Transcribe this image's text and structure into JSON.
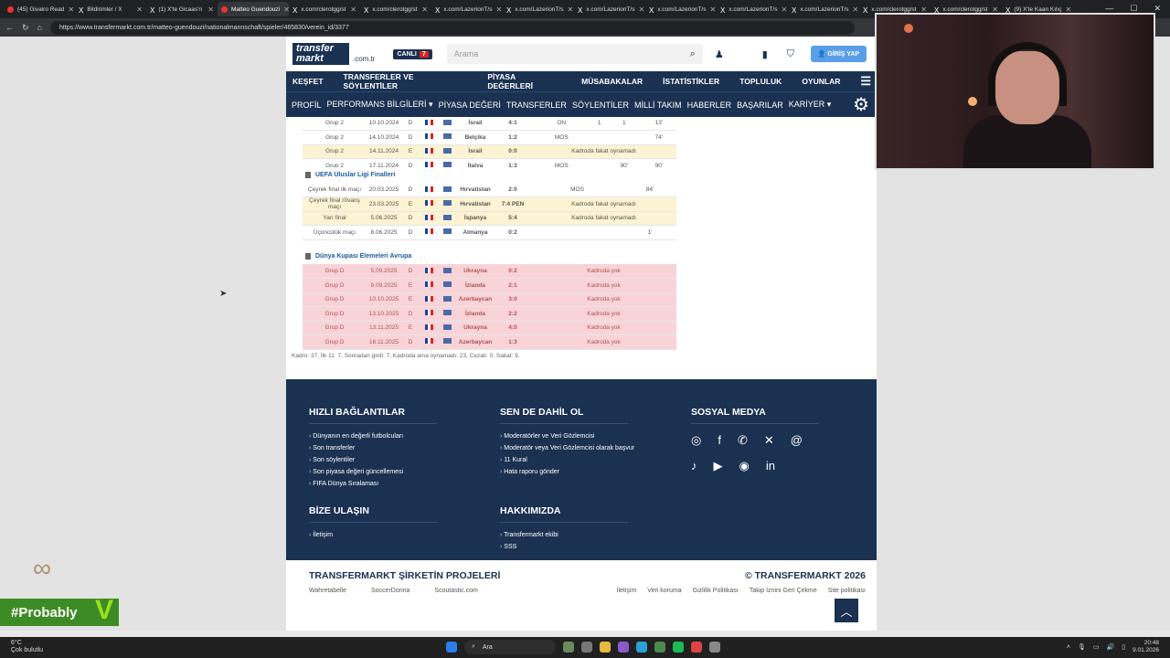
{
  "browser": {
    "tabs": [
      {
        "title": "(45) Givairo Read"
      },
      {
        "title": "Bildirimler / X"
      },
      {
        "title": "(1) X'te Gicaas'n"
      },
      {
        "title": "Matteo Guendouzi"
      },
      {
        "title": "x.com/clerotgg/st"
      },
      {
        "title": "x.com/clerotgg/st"
      },
      {
        "title": "x.com/LazerionT/s"
      },
      {
        "title": "x.com/LazerionT/s"
      },
      {
        "title": "x.com/LazerionT/s"
      },
      {
        "title": "x.com/LazerionT/s"
      },
      {
        "title": "x.com/LazerionT/s"
      },
      {
        "title": "x.com/LazerionT/s"
      },
      {
        "title": "x.com/clerotgg/st"
      },
      {
        "title": "x.com/clerotgg/st"
      },
      {
        "title": "(9) X'te Kaan Kılıç"
      }
    ],
    "url": "https://www.transfermarkt.com.tr/matteo-guendouzi/nationalmannschaft/spieler/465830/verein_id/3377"
  },
  "site": {
    "logo_top": "transfer",
    "logo_bottom": "markt",
    "domain": ".com.tr",
    "live_label": "CANLI",
    "live_count": "7",
    "search_placeholder": "Arama",
    "login_label": "GİRİŞ YAP",
    "nav_main": [
      "KEŞFET",
      "TRANSFERLER VE SÖYLENTİLER",
      "PİYASA DEĞERLERİ",
      "MÜSABAKALAR",
      "İSTATİSTİKLER",
      "TOPLULUK",
      "OYUNLAR"
    ],
    "nav_sub": [
      "PROFİL",
      "PERFORMANS BİLGİLERİ ▾",
      "PİYASA DEĞERİ",
      "TRANSFERLER",
      "SÖYLENTİLER",
      "MİLLİ TAKIM",
      "HABERLER",
      "BAŞARILAR",
      "KARİYER ▾"
    ]
  },
  "sections": {
    "nations_finals": "UEFA Uluslar Ligi Finalleri",
    "wc_qual": "Dünya Kupası Elemeleri Avrupa"
  },
  "matches_a": [
    {
      "comp": "Grup 2",
      "date": "10.10.2024",
      "ha": "D",
      "opp": "İsrail",
      "res": "4:1",
      "c6": "ON",
      "c7": "1",
      "c8": "1",
      "c9": "13'",
      "style": "plain"
    },
    {
      "comp": "Grup 2",
      "date": "14.10.2024",
      "ha": "D",
      "opp": "Belçika",
      "res": "1:2",
      "c6": "MOS",
      "c7": "",
      "c8": "",
      "c9": "74'",
      "style": "plain"
    },
    {
      "comp": "Grup 2",
      "date": "14.11.2024",
      "ha": "E",
      "opp": "İsrail",
      "res": "0:0",
      "note": "Kadroda fakat oynamadı",
      "style": "yel"
    },
    {
      "comp": "Grup 2",
      "date": "17.11.2024",
      "ha": "D",
      "opp": "İtalya",
      "res": "1:3",
      "c6": "MOS",
      "c7": "",
      "c8": "90'",
      "c9": "90'",
      "style": "plain"
    }
  ],
  "matches_b": [
    {
      "comp": "Çeyrek final ilk maçı",
      "date": "20.03.2025",
      "ha": "D",
      "opp": "Hırvatistan",
      "res": "2:0",
      "c6": "MOS",
      "c7": "",
      "c8": "",
      "c9": "84'",
      "style": "plain"
    },
    {
      "comp": "Çeyrek final rövanş maçı",
      "date": "23.03.2025",
      "ha": "E",
      "opp": "Hırvatistan",
      "res": "7:4 PEN",
      "note": "Kadroda fakat oynamadı",
      "style": "yel"
    },
    {
      "comp": "Yarı final",
      "date": "5.06.2025",
      "ha": "D",
      "opp": "İspanya",
      "res": "5:4",
      "note": "Kadroda fakat oynamadı",
      "style": "yel"
    },
    {
      "comp": "Üçüncülük maçı",
      "date": "8.06.2025",
      "ha": "D",
      "opp": "Almanya",
      "res": "0:2",
      "c6": "",
      "c7": "",
      "c8": "",
      "c9": "1'",
      "style": "plain"
    }
  ],
  "matches_c": [
    {
      "comp": "Grup D",
      "date": "5.09.2025",
      "ha": "D",
      "opp": "Ukrayna",
      "res": "0:2",
      "note": "Kadroda yok",
      "style": "red"
    },
    {
      "comp": "Grup D",
      "date": "9.09.2025",
      "ha": "E",
      "opp": "İzlanda",
      "res": "2:1",
      "note": "Kadroda yok",
      "style": "red"
    },
    {
      "comp": "Grup D",
      "date": "10.10.2025",
      "ha": "E",
      "opp": "Azerbaycan",
      "res": "3:0",
      "note": "Kadroda yok",
      "style": "red"
    },
    {
      "comp": "Grup D",
      "date": "13.10.2025",
      "ha": "D",
      "opp": "İzlanda",
      "res": "2:2",
      "note": "Kadroda yok",
      "style": "red"
    },
    {
      "comp": "Grup D",
      "date": "13.11.2025",
      "ha": "E",
      "opp": "Ukrayna",
      "res": "4:0",
      "note": "Kadroda yok",
      "style": "red"
    },
    {
      "comp": "Grup D",
      "date": "16.11.2025",
      "ha": "D",
      "opp": "Azerbaycan",
      "res": "1:3",
      "note": "Kadroda yok",
      "style": "red"
    }
  ],
  "footnote": "Kadro: 37, İlk 11: 7, Sonradan girdi: 7, Kadroda ama oynamadı: 23, Cezalı: 0, Sakat: 9,",
  "footer": {
    "quick_title": "HIZLI BAĞLANTILAR",
    "quick": [
      "Dünyanın en değerli futbolcuları",
      "Son transferler",
      "Son söylentiler",
      "Son piyasa değeri güncellemesi",
      "FIFA Dünya Sıralaması"
    ],
    "join_title": "SEN DE DAHİL OL",
    "join": [
      "Moderatörler ve Veri Gözlemcisi",
      "Moderatör veya Veri Gözlemcisi olarak başvur",
      "11 Kural",
      "Hata raporu gönder"
    ],
    "social_title": "SOSYAL MEDYA",
    "contact_title": "BİZE ULAŞIN",
    "contact": [
      "İletişim"
    ],
    "about_title": "HAKKIMIZDA",
    "about": [
      "Transfermarkt ekibi",
      "SSS"
    ],
    "projects_title": "TRANSFERMARKT ŞİRKETİN PROJELERİ",
    "projects": [
      "Wahretabelle",
      "SoccerDonna",
      "Scoutastic.com"
    ],
    "copyright": "© TRANSFERMARKT 2026",
    "legal": [
      "İletişim",
      "Veri koruma",
      "Gizlilik Politikası",
      "Takip İznini Geri Çekme",
      "Site politikası"
    ]
  },
  "overlay": {
    "text": "#Probably"
  },
  "taskbar": {
    "temp": "6°C",
    "weather": "Çok bulutlu",
    "search": "Ara",
    "time": "20:48",
    "date": "9.01.2026"
  }
}
